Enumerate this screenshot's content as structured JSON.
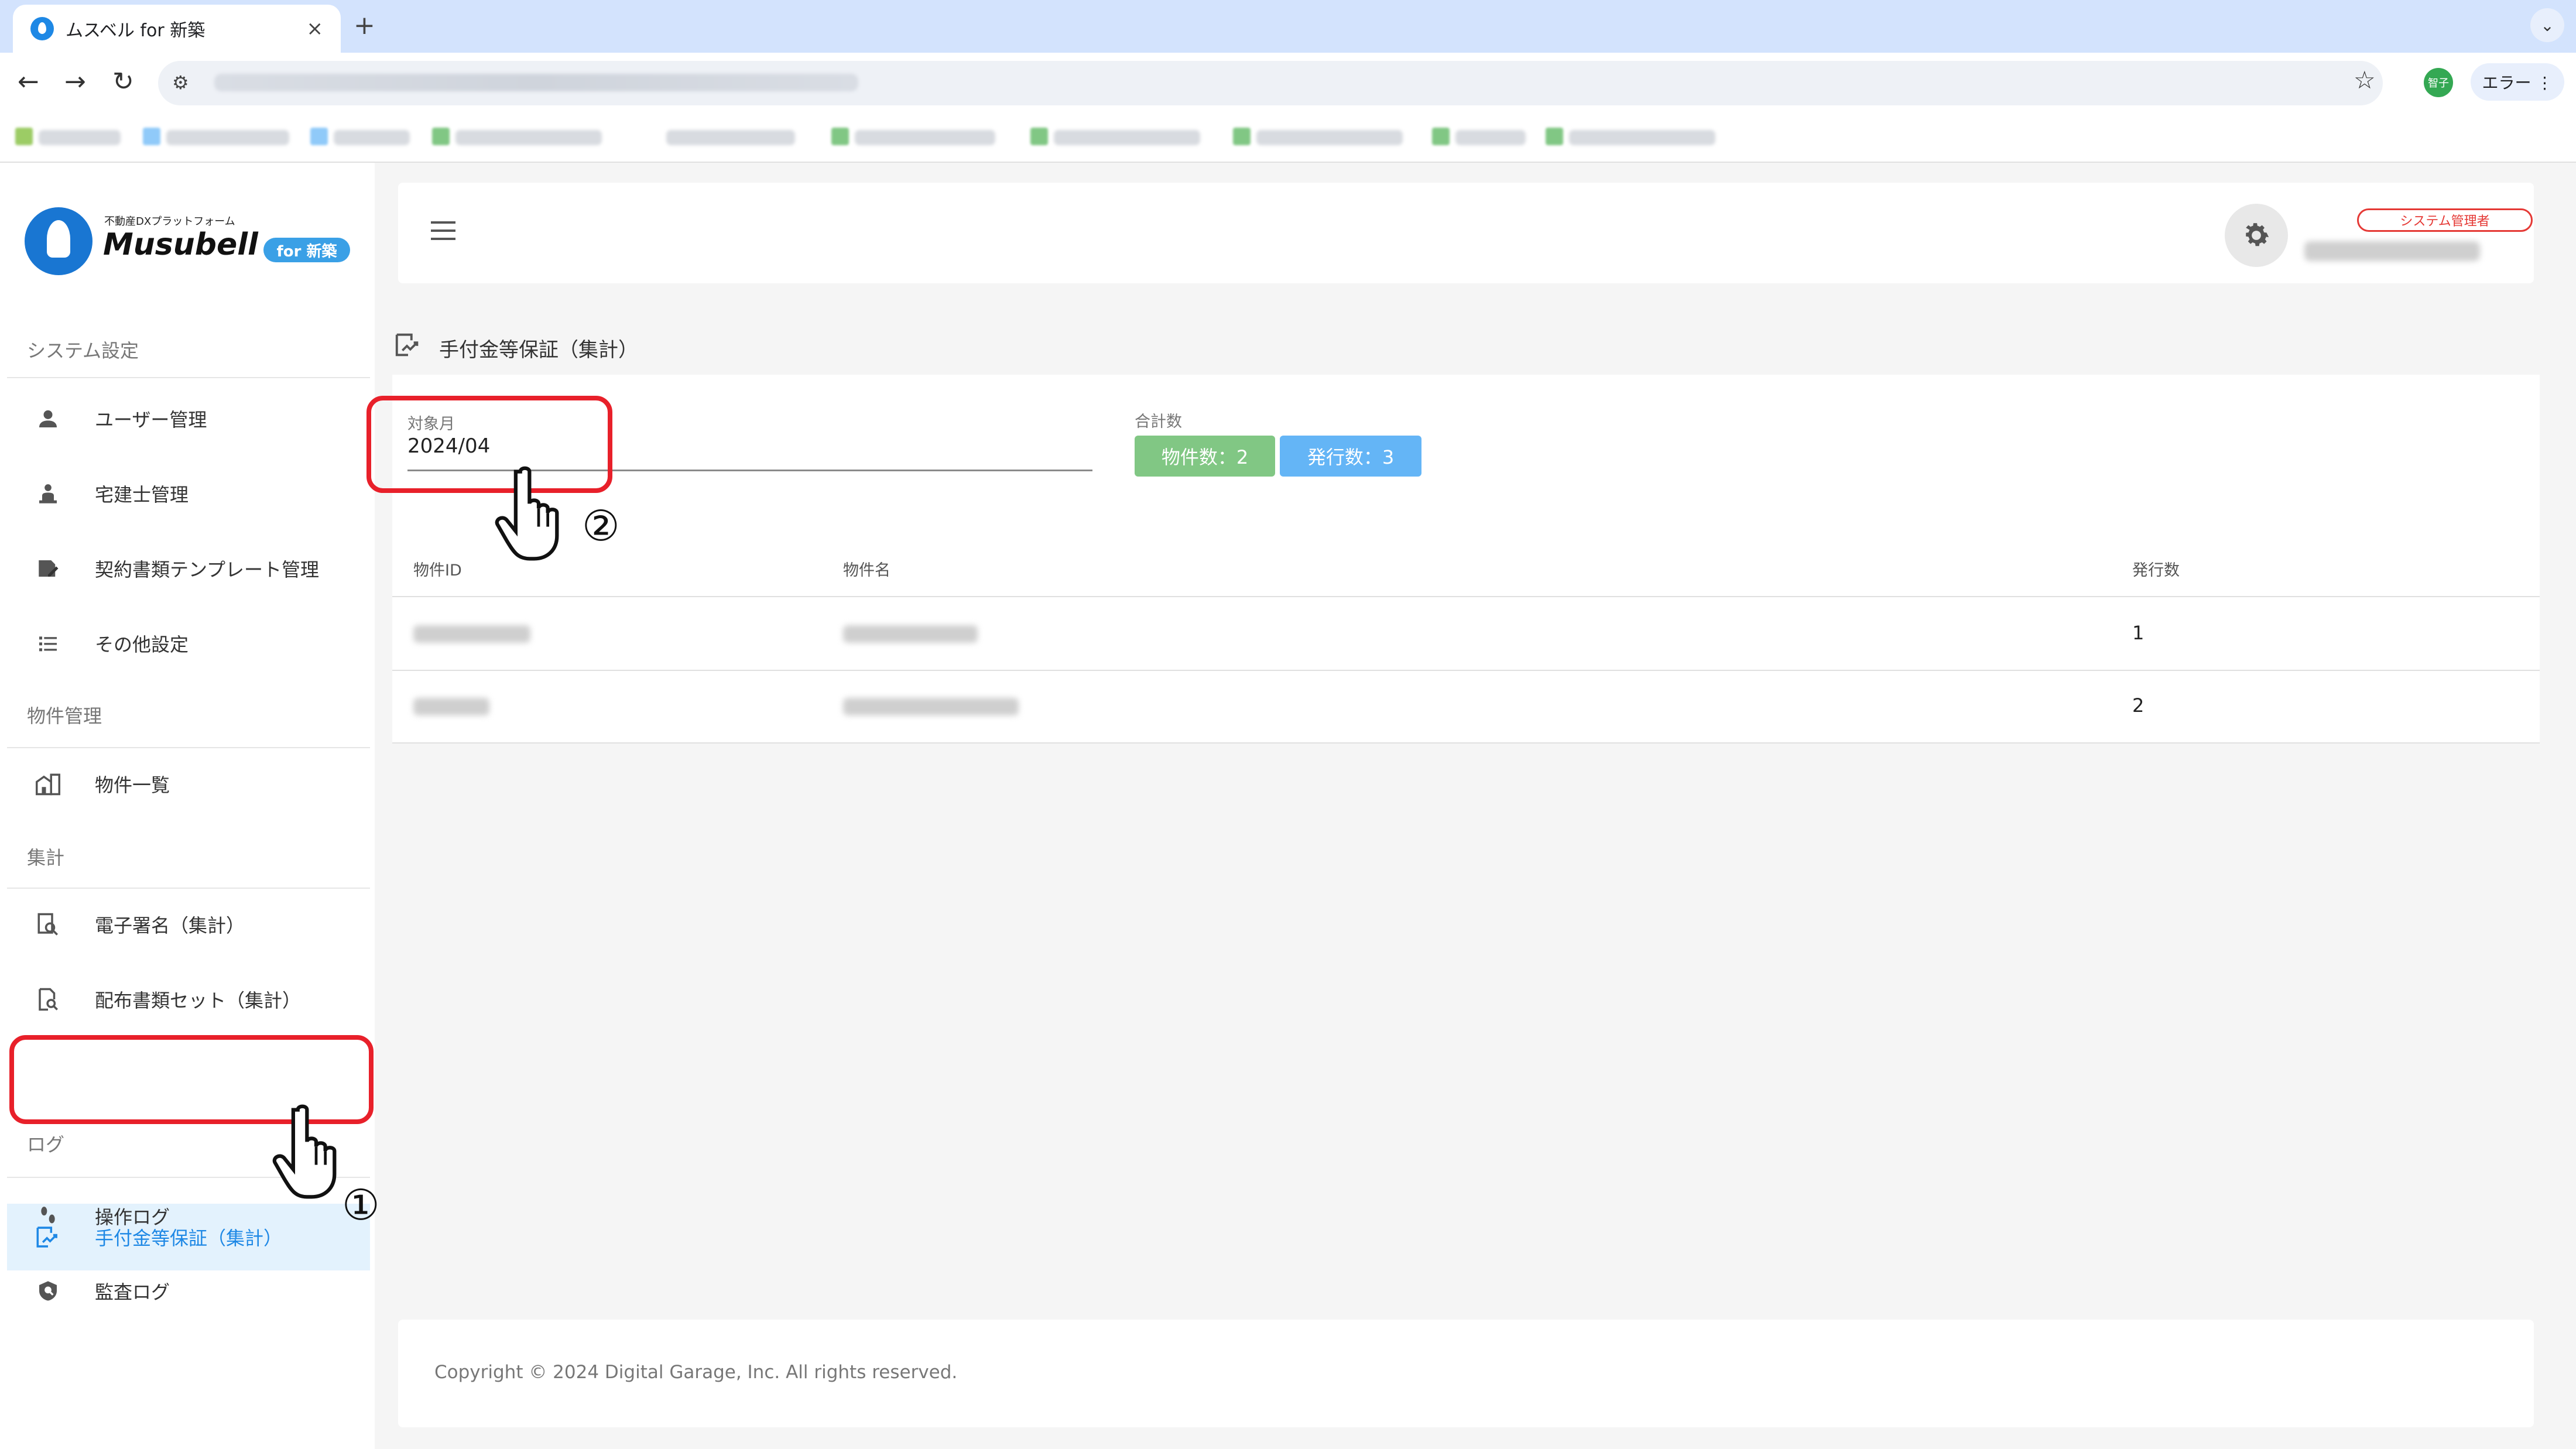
{
  "browser": {
    "tab_title": "ムスベル for 新築",
    "tab_close": "×",
    "new_tab": "+",
    "tab_menu": "⌄",
    "back": "←",
    "forward": "→",
    "reload": "↻",
    "star": "☆",
    "profile_initials": "智子",
    "error_button": "エラー ⋮"
  },
  "logo": {
    "subtitle": "不動産DXプラットフォーム",
    "name": "Musubell",
    "badge": "for 新築"
  },
  "sidebar": {
    "sections": [
      {
        "label": "システム設定",
        "items": [
          {
            "label": "ユーザー管理",
            "icon": "person-icon"
          },
          {
            "label": "宅建士管理",
            "icon": "agent-icon"
          },
          {
            "label": "契約書類テンプレート管理",
            "icon": "document-edit-icon"
          },
          {
            "label": "その他設定",
            "icon": "list-icon"
          }
        ]
      },
      {
        "label": "物件管理",
        "items": [
          {
            "label": "物件一覧",
            "icon": "building-icon"
          }
        ]
      },
      {
        "label": "集計",
        "items": [
          {
            "label": "電子署名（集計）",
            "icon": "document-search-icon"
          },
          {
            "label": "配布書類セット（集計）",
            "icon": "file-search-icon"
          },
          {
            "label": "手付金等保証（集計）",
            "icon": "chart-document-icon",
            "active": true
          }
        ]
      },
      {
        "label": "ログ",
        "items": [
          {
            "label": "操作ログ",
            "icon": "footsteps-icon"
          },
          {
            "label": "監査ログ",
            "icon": "shield-icon"
          }
        ]
      }
    ]
  },
  "header": {
    "role_badge": "システム管理者"
  },
  "page": {
    "title": "手付金等保証（集計）",
    "month_label": "対象月",
    "month_value": "2024/04",
    "totals_label": "合計数",
    "property_count": "物件数：2",
    "issue_count": "発行数：3"
  },
  "table": {
    "columns": [
      "物件ID",
      "物件名",
      "発行数"
    ],
    "rows": [
      {
        "issue_count": "1"
      },
      {
        "issue_count": "2"
      }
    ]
  },
  "footer": {
    "copyright": "Copyright © 2024 Digital Garage, Inc. All rights reserved."
  },
  "annotations": {
    "marker_1": "①",
    "marker_2": "②"
  },
  "colors": {
    "accent": "#1e88e5",
    "callout": "#e8202a",
    "chip_green": "#81c784",
    "chip_blue": "#64b5f6"
  }
}
